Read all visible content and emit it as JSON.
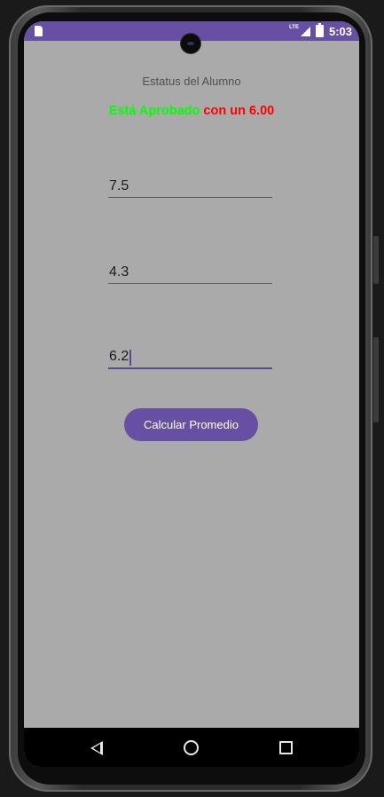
{
  "status_bar": {
    "network": "LTE",
    "time": "5:03"
  },
  "app": {
    "title": "Estatus del Alumno",
    "result": {
      "status_text": "Está Aprobado",
      "average_text": "con un 6.00",
      "status_color": "#00ff00",
      "average_color": "#ff0000"
    },
    "grades": [
      {
        "value": "7.5"
      },
      {
        "value": "4.3"
      },
      {
        "value": "6.2"
      }
    ],
    "calculate_button": "Calcular Promedio"
  },
  "colors": {
    "accent": "#6750a4",
    "background": "#aaaaaa"
  },
  "icons": {
    "sim": "sim-card-icon",
    "signal": "signal-icon",
    "battery": "battery-icon",
    "back": "back-icon",
    "home": "home-icon",
    "recents": "recents-icon"
  }
}
